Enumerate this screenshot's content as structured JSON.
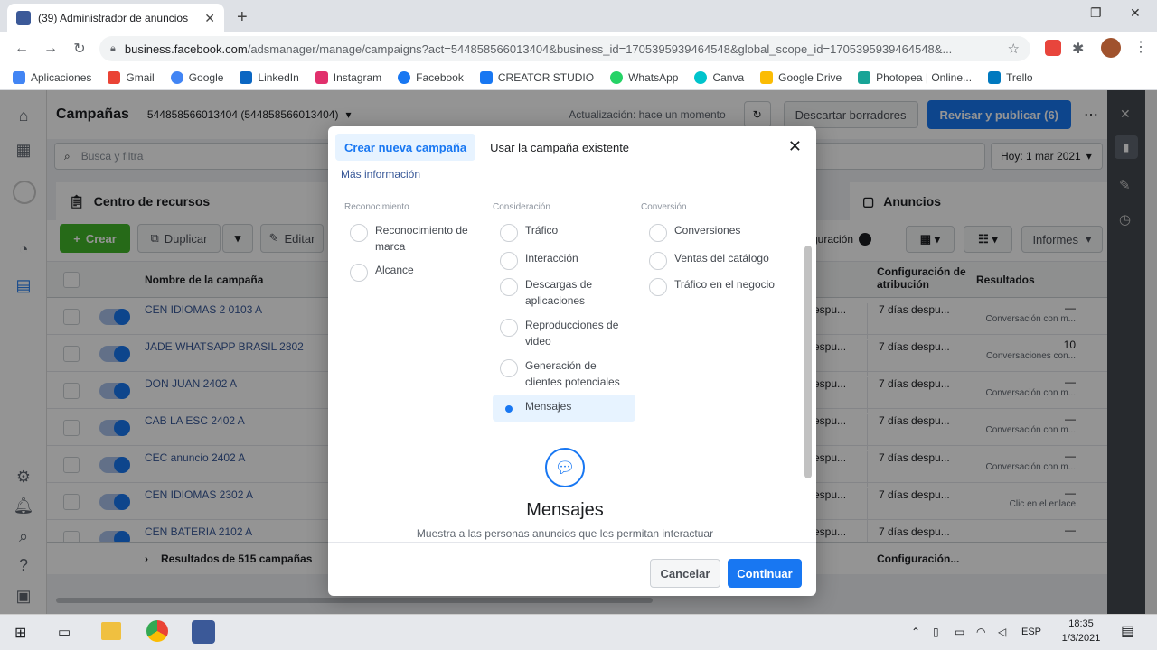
{
  "browser": {
    "tab_title": "(39) Administrador de anuncios",
    "url_host": "business.facebook.com",
    "url_rest": "/adsmanager/manage/campaigns?act=544858566013404&business_id=1705395939464548&global_scope_id=1705395939464548&...",
    "bookmarks": [
      {
        "label": "Aplicaciones",
        "color": "#4285f4"
      },
      {
        "label": "Gmail",
        "color": "#ea4335"
      },
      {
        "label": "Google",
        "color": "#4285f4"
      },
      {
        "label": "LinkedIn",
        "color": "#0a66c2"
      },
      {
        "label": "Instagram",
        "color": "#e1306c"
      },
      {
        "label": "Facebook",
        "color": "#1877f2"
      },
      {
        "label": "CREATOR STUDIO",
        "color": "#1877f2"
      },
      {
        "label": "WhatsApp",
        "color": "#25d366"
      },
      {
        "label": "Canva",
        "color": "#00c4cc"
      },
      {
        "label": "Google Drive",
        "color": "#fbbc04"
      },
      {
        "label": "Photopea | Online...",
        "color": "#18a497"
      },
      {
        "label": "Trello",
        "color": "#0079bf"
      }
    ]
  },
  "app": {
    "section_title": "Campañas",
    "account": "544858566013404 (544858566013404)",
    "update_status": "Actualización: hace un momento",
    "discard_label": "Descartar borradores",
    "publish_label": "Revisar y publicar (6)",
    "search_placeholder": "Busca y filtra",
    "date_label": "Hoy: 1 mar 2021",
    "resources_label": "Centro de recursos",
    "ads_label": "Anuncios",
    "create_label": "Crear",
    "duplicate_label": "Duplicar",
    "edit_label": "Editar",
    "config_label": "guración",
    "reports_label": "Informes",
    "col_name": "Nombre de la campaña",
    "col_attr": "Configuración de atribución",
    "col_results": "Resultados",
    "footer_results": "Resultados de 515 campañas",
    "footer_config": "Configuración...",
    "rows": [
      {
        "name": "CEN IDIOMAS 2 0103 A",
        "c1": "espu...",
        "c2": "7 días despu...",
        "c3a": "—",
        "c3b": "Conversación con m..."
      },
      {
        "name": "JADE WHATSAPP BRASIL 2802",
        "c1": "espu...",
        "c2": "7 días despu...",
        "c3a": "10",
        "c3b": "Conversaciones con..."
      },
      {
        "name": "DON JUAN 2402 A",
        "c1": "espu...",
        "c2": "7 días despu...",
        "c3a": "—",
        "c3b": "Conversación con m..."
      },
      {
        "name": "CAB LA ESC 2402 A",
        "c1": "espu...",
        "c2": "7 días despu...",
        "c3a": "—",
        "c3b": "Conversación con m..."
      },
      {
        "name": "CEC anuncio 2402 A",
        "c1": "espu...",
        "c2": "7 días despu...",
        "c3a": "—",
        "c3b": "Conversación con m..."
      },
      {
        "name": "CEN IDIOMAS 2302 A",
        "c1": "espu...",
        "c2": "7 días despu...",
        "c3a": "—",
        "c3b": "Clic en el enlace"
      },
      {
        "name": "CEN BATERIA 2102 A",
        "c1": "espu...",
        "c2": "7 días despu...",
        "c3a": "—",
        "c3b": ""
      }
    ]
  },
  "modal": {
    "tab_new": "Crear nueva campaña",
    "tab_existing": "Usar la campaña existente",
    "more_info": "Más información",
    "col_awareness": "Reconocimiento",
    "col_consideration": "Consideración",
    "col_conversion": "Conversión",
    "awareness": [
      "Reconocimiento de marca",
      "Alcance"
    ],
    "consideration": [
      "Tráfico",
      "Interacción",
      "Descargas de aplicaciones",
      "Reproducciones de video",
      "Generación de clientes potenciales",
      "Mensajes"
    ],
    "conversion": [
      "Conversiones",
      "Ventas del catálogo",
      "Tráfico en el negocio"
    ],
    "selected_title": "Mensajes",
    "selected_desc": "Muestra a las personas anuncios que les permitan interactuar",
    "cancel": "Cancelar",
    "continue": "Continuar"
  },
  "taskbar": {
    "lang": "ESP",
    "time": "18:35",
    "date": "1/3/2021"
  },
  "colors": {
    "accent": "#1877f2",
    "create_green": "#42b72a",
    "overlay": "rgba(0,0,0,0.42)"
  }
}
